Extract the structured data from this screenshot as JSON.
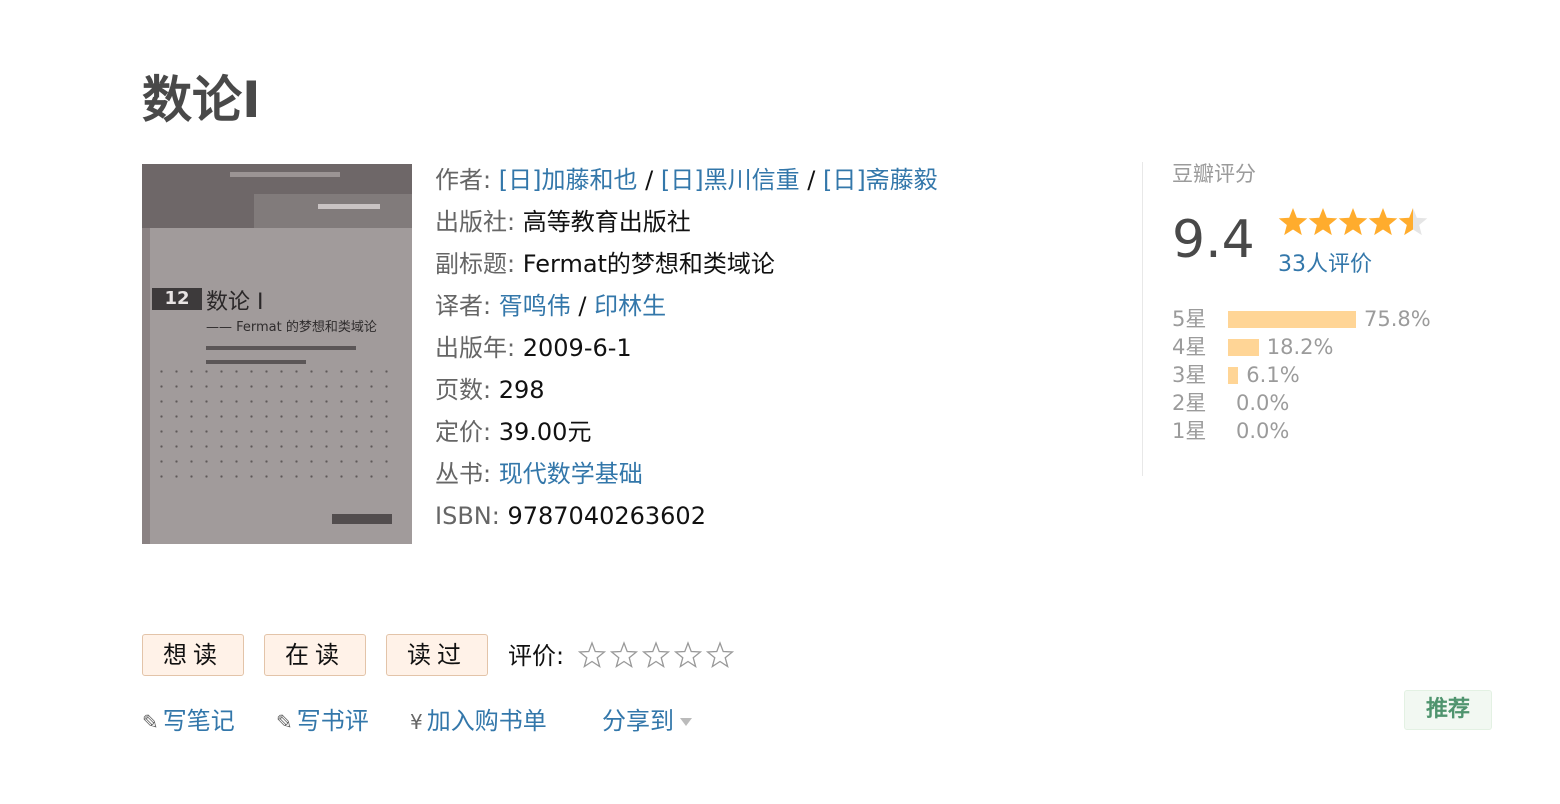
{
  "book": {
    "title": "数论I"
  },
  "cover": {
    "series_no": "12",
    "title": "数论 I",
    "subtitle": "—— Fermat 的梦想和类域论"
  },
  "info": {
    "author_label": "作者:",
    "authors": [
      "[日]加藤和也",
      "[日]黑川信重",
      "[日]斋藤毅"
    ],
    "separator": "/",
    "publisher_label": "出版社:",
    "publisher": "高等教育出版社",
    "subtitle_label": "副标题:",
    "subtitle": "Fermat的梦想和类域论",
    "translator_label": "译者:",
    "translators": [
      "胥鸣伟",
      "印林生"
    ],
    "pubyear_label": "出版年:",
    "pubyear": "2009-6-1",
    "pages_label": "页数:",
    "pages": "298",
    "price_label": "定价:",
    "price": "39.00元",
    "series_label": "丛书:",
    "series": "现代数学基础",
    "isbn_label": "ISBN:",
    "isbn": "9787040263602"
  },
  "rating": {
    "title": "豆瓣评分",
    "score": "9.4",
    "stars": 4.5,
    "count": "33人评价",
    "star_color": "#ffac2d",
    "bar_color": "#ffd596",
    "distribution": [
      {
        "label": "5星",
        "pct": "75.8%",
        "value": 75.8
      },
      {
        "label": "4星",
        "pct": "18.2%",
        "value": 18.2
      },
      {
        "label": "3星",
        "pct": "6.1%",
        "value": 6.1
      },
      {
        "label": "2星",
        "pct": "0.0%",
        "value": 0.0
      },
      {
        "label": "1星",
        "pct": "0.0%",
        "value": 0.0
      }
    ]
  },
  "actions": {
    "want": "想读",
    "reading": "在读",
    "read": "读过",
    "rate_label": "评价:",
    "write_note": "写笔记",
    "write_review": "写书评",
    "add_cart": "加入购书单",
    "share": "分享到",
    "recommend": "推荐",
    "pencil_icon": "pencil-icon",
    "yen_icon": "yen-icon"
  }
}
